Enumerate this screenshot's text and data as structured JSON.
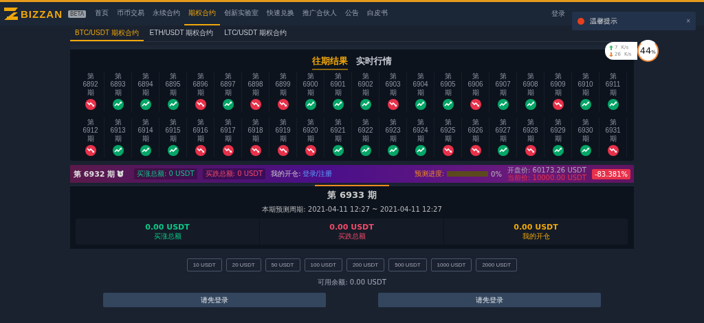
{
  "header": {
    "logo": "BIZZAN",
    "badge": "BETA",
    "nav": [
      {
        "label": "首页",
        "selected": false
      },
      {
        "label": "币币交易",
        "selected": false
      },
      {
        "label": "永续合约",
        "selected": false
      },
      {
        "label": "期权合约",
        "selected": true
      },
      {
        "label": "创新实验室",
        "selected": false
      },
      {
        "label": "快速兑换",
        "selected": false
      },
      {
        "label": "推广合伙人",
        "selected": false
      },
      {
        "label": "公告",
        "selected": false
      },
      {
        "label": "白皮书",
        "selected": false
      }
    ],
    "login": "登录"
  },
  "notification": {
    "title": "温馨提示",
    "close": "×"
  },
  "speed_widget": {
    "up": "7",
    "up_unit": "K/s",
    "down": "26",
    "down_unit": "K/s",
    "percent": "44",
    "percent_unit": "%"
  },
  "tabs": [
    {
      "label": "BTC/USDT 期权合约",
      "selected": true
    },
    {
      "label": "ETH/USDT 期权合约",
      "selected": false
    },
    {
      "label": "LTC/USDT 期权合约",
      "selected": false
    }
  ],
  "view_tabs": [
    {
      "label": "往期结果",
      "selected": true
    },
    {
      "label": "实时行情",
      "selected": false
    }
  ],
  "periods": [
    {
      "prefix": "第",
      "number": "6892",
      "suffix": "期",
      "kind": "down"
    },
    {
      "prefix": "第",
      "number": "6893",
      "suffix": "期",
      "kind": "up"
    },
    {
      "prefix": "第",
      "number": "6894",
      "suffix": "期",
      "kind": "up"
    },
    {
      "prefix": "第",
      "number": "6895",
      "suffix": "期",
      "kind": "up"
    },
    {
      "prefix": "第",
      "number": "6896",
      "suffix": "期",
      "kind": "down"
    },
    {
      "prefix": "第",
      "number": "6897",
      "suffix": "期",
      "kind": "up"
    },
    {
      "prefix": "第",
      "number": "6898",
      "suffix": "期",
      "kind": "down"
    },
    {
      "prefix": "第",
      "number": "6899",
      "suffix": "期",
      "kind": "down"
    },
    {
      "prefix": "第",
      "number": "6900",
      "suffix": "期",
      "kind": "up"
    },
    {
      "prefix": "第",
      "number": "6901",
      "suffix": "期",
      "kind": "up"
    },
    {
      "prefix": "第",
      "number": "6902",
      "suffix": "期",
      "kind": "up"
    },
    {
      "prefix": "第",
      "number": "6903",
      "suffix": "期",
      "kind": "down"
    },
    {
      "prefix": "第",
      "number": "6904",
      "suffix": "期",
      "kind": "up"
    },
    {
      "prefix": "第",
      "number": "6905",
      "suffix": "期",
      "kind": "up"
    },
    {
      "prefix": "第",
      "number": "6906",
      "suffix": "期",
      "kind": "down"
    },
    {
      "prefix": "第",
      "number": "6907",
      "suffix": "期",
      "kind": "up"
    },
    {
      "prefix": "第",
      "number": "6908",
      "suffix": "期",
      "kind": "up"
    },
    {
      "prefix": "第",
      "number": "6909",
      "suffix": "期",
      "kind": "down"
    },
    {
      "prefix": "第",
      "number": "6910",
      "suffix": "期",
      "kind": "up"
    },
    {
      "prefix": "第",
      "number": "6911",
      "suffix": "期",
      "kind": "up"
    },
    {
      "prefix": "第",
      "number": "6912",
      "suffix": "期",
      "kind": "down"
    },
    {
      "prefix": "第",
      "number": "6913",
      "suffix": "期",
      "kind": "up"
    },
    {
      "prefix": "第",
      "number": "6914",
      "suffix": "期",
      "kind": "up"
    },
    {
      "prefix": "第",
      "number": "6915",
      "suffix": "期",
      "kind": "up"
    },
    {
      "prefix": "第",
      "number": "6916",
      "suffix": "期",
      "kind": "down"
    },
    {
      "prefix": "第",
      "number": "6917",
      "suffix": "期",
      "kind": "down"
    },
    {
      "prefix": "第",
      "number": "6918",
      "suffix": "期",
      "kind": "down"
    },
    {
      "prefix": "第",
      "number": "6919",
      "suffix": "期",
      "kind": "down"
    },
    {
      "prefix": "第",
      "number": "6920",
      "suffix": "期",
      "kind": "down"
    },
    {
      "prefix": "第",
      "number": "6921",
      "suffix": "期",
      "kind": "up"
    },
    {
      "prefix": "第",
      "number": "6922",
      "suffix": "期",
      "kind": "up"
    },
    {
      "prefix": "第",
      "number": "6923",
      "suffix": "期",
      "kind": "up"
    },
    {
      "prefix": "第",
      "number": "6924",
      "suffix": "期",
      "kind": "up"
    },
    {
      "prefix": "第",
      "number": "6925",
      "suffix": "期",
      "kind": "down"
    },
    {
      "prefix": "第",
      "number": "6926",
      "suffix": "期",
      "kind": "down"
    },
    {
      "prefix": "第",
      "number": "6927",
      "suffix": "期",
      "kind": "up"
    },
    {
      "prefix": "第",
      "number": "6928",
      "suffix": "期",
      "kind": "down"
    },
    {
      "prefix": "第",
      "number": "6929",
      "suffix": "期",
      "kind": "up"
    },
    {
      "prefix": "第",
      "number": "6930",
      "suffix": "期",
      "kind": "up"
    },
    {
      "prefix": "第",
      "number": "6931",
      "suffix": "期",
      "kind": "down"
    }
  ],
  "current_bar": {
    "period": "第 6932 期",
    "buy_up": "买涨总额: 0 USDT",
    "buy_down": "买跌总额: 0 USDT",
    "my_position_label": "我的开仓:",
    "login_link": "登录/注册",
    "progress_label": "预测进度:",
    "level": 0,
    "progress_text": "0%",
    "open_price": "开盘价: 60173.26 USDT",
    "current_price": "当前价: 10000.00 USDT",
    "change": "-83.381%"
  },
  "next": {
    "title": "第 6933 期",
    "cycle": "本期预测周期: 2021-04-11 12:27 ~ 2021-04-11 12:27",
    "stats": [
      {
        "value": "0.00 USDT",
        "label": "买涨总额",
        "kind": "up"
      },
      {
        "value": "0.00 USDT",
        "label": "买跌总额",
        "kind": "down"
      },
      {
        "value": "0.00 USDT",
        "label": "我的开仓",
        "kind": "mine"
      }
    ]
  },
  "amounts": [
    "10 USDT",
    "20 USDT",
    "50 USDT",
    "100 USDT",
    "200 USDT",
    "500 USDT",
    "1000 USDT",
    "2000 USDT"
  ],
  "balance": "可用余额: 0.00 USDT",
  "actions": [
    "请先登录",
    "请先登录"
  ]
}
